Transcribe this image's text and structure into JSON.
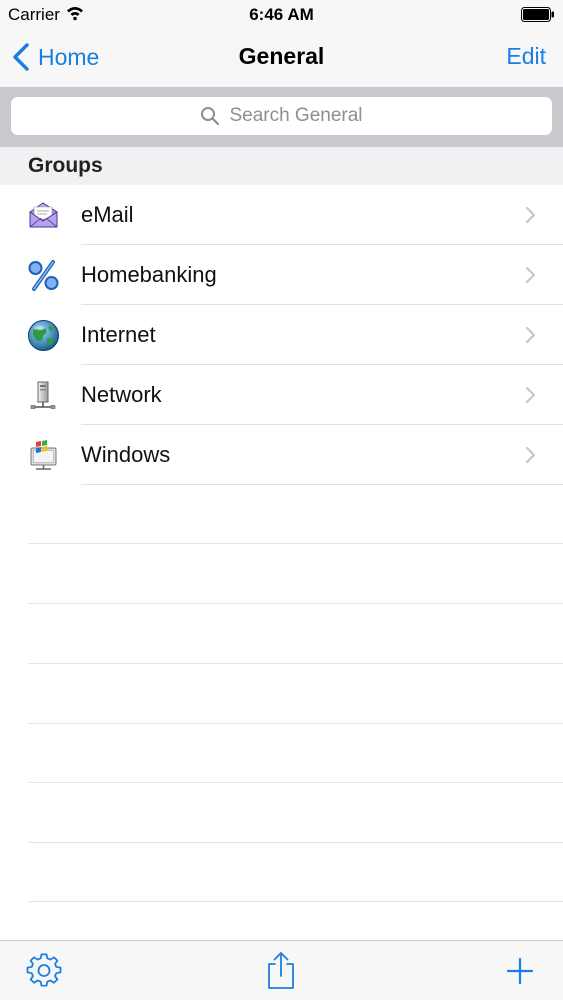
{
  "status_bar": {
    "carrier": "Carrier",
    "time": "6:46 AM"
  },
  "nav": {
    "back_label": "Home",
    "title": "General",
    "edit_label": "Edit"
  },
  "search": {
    "placeholder": "Search General"
  },
  "section": {
    "title": "Groups"
  },
  "groups": [
    {
      "label": "eMail",
      "icon": "email-envelope-icon"
    },
    {
      "label": "Homebanking",
      "icon": "percent-icon"
    },
    {
      "label": "Internet",
      "icon": "globe-icon"
    },
    {
      "label": "Network",
      "icon": "network-computer-icon"
    },
    {
      "label": "Windows",
      "icon": "windows-computer-icon"
    }
  ],
  "toolbar": {
    "settings_icon": "gear-icon",
    "share_icon": "share-icon",
    "add_icon": "plus-icon"
  },
  "colors": {
    "accent": "#1a7fe0",
    "nav_background": "#f7f7f8",
    "search_background": "#c9c9ce",
    "section_background": "#f1f1f3"
  }
}
